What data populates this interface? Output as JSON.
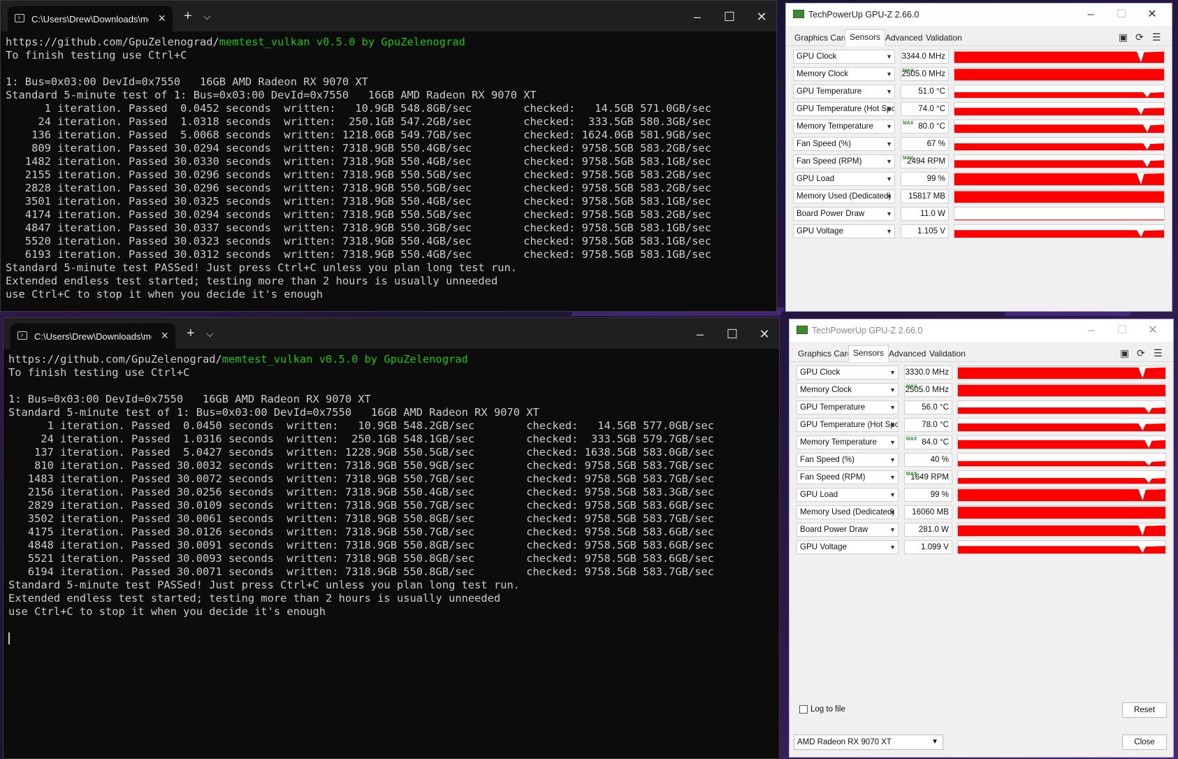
{
  "terminal1": {
    "tab_title": "C:\\Users\\Drew\\Downloads\\me",
    "link": "https://github.com/GpuZelenograd/",
    "version": "memtest_vulkan v0.5.0 by GpuZelenograd",
    "lines": [
      "To finish testing use Ctrl+C",
      "",
      "1: Bus=0x03:00 DevId=0x7550   16GB AMD Radeon RX 9070 XT",
      "Standard 5-minute test of 1: Bus=0x03:00 DevId=0x7550   16GB AMD Radeon RX 9070 XT",
      "      1 iteration. Passed  0.0452 seconds  written:   10.9GB 548.8GB/sec        checked:   14.5GB 571.0GB/sec",
      "     24 iteration. Passed  1.0318 seconds  written:  250.1GB 547.2GB/sec        checked:  333.5GB 580.3GB/sec",
      "    136 iteration. Passed  5.0068 seconds  written: 1218.0GB 549.7GB/sec        checked: 1624.0GB 581.9GB/sec",
      "    809 iteration. Passed 30.0294 seconds  written: 7318.9GB 550.4GB/sec        checked: 9758.5GB 583.2GB/sec",
      "   1482 iteration. Passed 30.0330 seconds  written: 7318.9GB 550.4GB/sec        checked: 9758.5GB 583.1GB/sec",
      "   2155 iteration. Passed 30.0296 seconds  written: 7318.9GB 550.5GB/sec        checked: 9758.5GB 583.2GB/sec",
      "   2828 iteration. Passed 30.0296 seconds  written: 7318.9GB 550.5GB/sec        checked: 9758.5GB 583.2GB/sec",
      "   3501 iteration. Passed 30.0325 seconds  written: 7318.9GB 550.4GB/sec        checked: 9758.5GB 583.1GB/sec",
      "   4174 iteration. Passed 30.0294 seconds  written: 7318.9GB 550.5GB/sec        checked: 9758.5GB 583.2GB/sec",
      "   4847 iteration. Passed 30.0337 seconds  written: 7318.9GB 550.3GB/sec        checked: 9758.5GB 583.1GB/sec",
      "   5520 iteration. Passed 30.0323 seconds  written: 7318.9GB 550.4GB/sec        checked: 9758.5GB 583.1GB/sec",
      "   6193 iteration. Passed 30.0312 seconds  written: 7318.9GB 550.4GB/sec        checked: 9758.5GB 583.1GB/sec",
      "Standard 5-minute test PASSed! Just press Ctrl+C unless you plan long test run.",
      "Extended endless test started; testing more than 2 hours is usually unneeded",
      "use Ctrl+C to stop it when you decide it's enough"
    ]
  },
  "terminal2": {
    "tab_title": "C:\\Users\\Drew\\Downloads\\me",
    "link": "https://github.com/GpuZelenograd/",
    "version": "memtest_vulkan v0.5.0 by GpuZelenograd",
    "lines": [
      "To finish testing use Ctrl+C",
      "",
      "1: Bus=0x03:00 DevId=0x7550   16GB AMD Radeon RX 9070 XT",
      "Standard 5-minute test of 1: Bus=0x03:00 DevId=0x7550   16GB AMD Radeon RX 9070 XT",
      "      1 iteration. Passed  0.0450 seconds  written:   10.9GB 548.2GB/sec        checked:   14.5GB 577.0GB/sec",
      "     24 iteration. Passed  1.0316 seconds  written:  250.1GB 548.1GB/sec        checked:  333.5GB 579.7GB/sec",
      "    137 iteration. Passed  5.0427 seconds  written: 1228.9GB 550.5GB/sec        checked: 1638.5GB 583.0GB/sec",
      "    810 iteration. Passed 30.0032 seconds  written: 7318.9GB 550.9GB/sec        checked: 9758.5GB 583.7GB/sec",
      "   1483 iteration. Passed 30.0072 seconds  written: 7318.9GB 550.7GB/sec        checked: 9758.5GB 583.7GB/sec",
      "   2156 iteration. Passed 30.0256 seconds  written: 7318.9GB 550.4GB/sec        checked: 9758.5GB 583.3GB/sec",
      "   2829 iteration. Passed 30.0109 seconds  written: 7318.9GB 550.7GB/sec        checked: 9758.5GB 583.6GB/sec",
      "   3502 iteration. Passed 30.0061 seconds  written: 7318.9GB 550.8GB/sec        checked: 9758.5GB 583.7GB/sec",
      "   4175 iteration. Passed 30.0126 seconds  written: 7318.9GB 550.7GB/sec        checked: 9758.5GB 583.6GB/sec",
      "   4848 iteration. Passed 30.0091 seconds  written: 7318.9GB 550.8GB/sec        checked: 9758.5GB 583.6GB/sec",
      "   5521 iteration. Passed 30.0093 seconds  written: 7318.9GB 550.8GB/sec        checked: 9758.5GB 583.6GB/sec",
      "   6194 iteration. Passed 30.0071 seconds  written: 7318.9GB 550.8GB/sec        checked: 9758.5GB 583.7GB/sec",
      "Standard 5-minute test PASSed! Just press Ctrl+C unless you plan long test run.",
      "Extended endless test started; testing more than 2 hours is usually unneeded",
      "use Ctrl+C to stop it when you decide it's enough"
    ]
  },
  "gpuz_common": {
    "title": "TechPowerUp GPU-Z 2.66.0",
    "tabs": [
      "Graphics Card",
      "Sensors",
      "Advanced",
      "Validation"
    ],
    "max_label": "MAX",
    "graph_color": "#ff0000",
    "log_label": "Log to file",
    "reset_label": "Reset",
    "close_label": "Close",
    "device": "AMD Radeon RX 9070 XT"
  },
  "gpuz1": {
    "sensors": [
      {
        "label": "GPU Clock",
        "value": "3344.0 MHz",
        "max": false,
        "level": 0.9,
        "dip": 0.87
      },
      {
        "label": "Memory Clock",
        "value": "2505.0 MHz",
        "max": true,
        "level": 0.92,
        "dip": -1
      },
      {
        "label": "GPU Temperature",
        "value": "51.0 °C",
        "max": false,
        "level": 0.45,
        "dip": 0.9
      },
      {
        "label": "GPU Temperature (Hot Spot)",
        "value": "74.0 °C",
        "max": false,
        "level": 0.6,
        "dip": 0.87
      },
      {
        "label": "Memory Temperature",
        "value": "80.0 °C",
        "max": true,
        "level": 0.65,
        "dip": 0.9
      },
      {
        "label": "Fan Speed (%)",
        "value": "67 %",
        "max": false,
        "level": 0.55,
        "dip": 0.9
      },
      {
        "label": "Fan Speed (RPM)",
        "value": "2494 RPM",
        "max": true,
        "level": 0.6,
        "dip": 0.9
      },
      {
        "label": "GPU Load",
        "value": "99 %",
        "max": false,
        "level": 0.95,
        "dip": 0.87
      },
      {
        "label": "Memory Used (Dedicated)",
        "value": "15817 MB",
        "max": false,
        "level": 0.92,
        "dip": -1
      },
      {
        "label": "Board Power Draw",
        "value": "11.0 W",
        "max": false,
        "level": 0.05,
        "dip": -1
      },
      {
        "label": "GPU Voltage",
        "value": "1.105 V",
        "max": false,
        "level": 0.6,
        "dip": 0.87
      }
    ]
  },
  "gpuz2": {
    "sensors": [
      {
        "label": "GPU Clock",
        "value": "3330.0 MHz",
        "max": false,
        "level": 0.9,
        "dip": 0.87
      },
      {
        "label": "Memory Clock",
        "value": "2505.0 MHz",
        "max": true,
        "level": 0.92,
        "dip": -1
      },
      {
        "label": "GPU Temperature",
        "value": "56.0 °C",
        "max": false,
        "level": 0.5,
        "dip": 0.9
      },
      {
        "label": "GPU Temperature (Hot Spot)",
        "value": "78.0 °C",
        "max": false,
        "level": 0.62,
        "dip": 0.87
      },
      {
        "label": "Memory Temperature",
        "value": "84.0 °C",
        "max": true,
        "level": 0.68,
        "dip": 0.9
      },
      {
        "label": "Fan Speed (%)",
        "value": "40 %",
        "max": false,
        "level": 0.4,
        "dip": 0.9
      },
      {
        "label": "Fan Speed (RPM)",
        "value": "1649 RPM",
        "max": true,
        "level": 0.45,
        "dip": 0.9
      },
      {
        "label": "GPU Load",
        "value": "99 %",
        "max": false,
        "level": 0.95,
        "dip": 0.87
      },
      {
        "label": "Memory Used (Dedicated)",
        "value": "16060 MB",
        "max": false,
        "level": 0.94,
        "dip": -1
      },
      {
        "label": "Board Power Draw",
        "value": "281.0 W",
        "max": false,
        "level": 0.85,
        "dip": 0.87
      },
      {
        "label": "GPU Voltage",
        "value": "1.099 V",
        "max": false,
        "level": 0.6,
        "dip": 0.87
      }
    ]
  }
}
